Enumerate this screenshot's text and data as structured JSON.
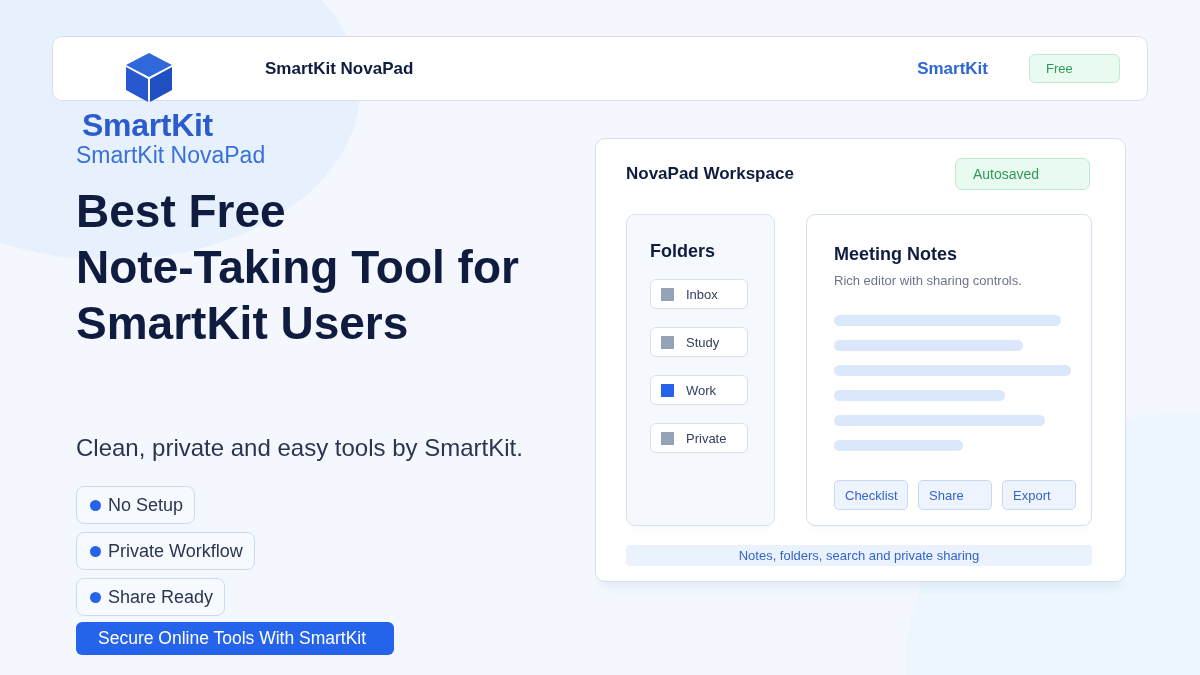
{
  "logo": {
    "wordmark": "SmartKit"
  },
  "header": {
    "title": "SmartKit NovaPad",
    "link": "SmartKit",
    "badge": "Free"
  },
  "hero": {
    "eyebrow": "SmartKit NovaPad",
    "heading_lines": [
      "Best Free",
      "Note-Taking Tool for",
      "SmartKit Users"
    ],
    "subtitle": "Clean, private and easy tools by SmartKit.",
    "features": [
      "No Setup",
      "Private Workflow",
      "Share Ready"
    ],
    "cta": "Secure Online Tools With SmartKit"
  },
  "workspace": {
    "title": "NovaPad Workspace",
    "status": "Autosaved",
    "folders": {
      "title": "Folders",
      "items": [
        {
          "label": "Inbox",
          "selected": false
        },
        {
          "label": "Study",
          "selected": false
        },
        {
          "label": "Work",
          "selected": true
        },
        {
          "label": "Private",
          "selected": false
        }
      ]
    },
    "editor": {
      "title": "Meeting Notes",
      "subtitle": "Rich editor with sharing controls.",
      "actions": [
        "Checklist",
        "Share",
        "Export"
      ]
    },
    "footer": "Notes, folders, search and private sharing"
  }
}
